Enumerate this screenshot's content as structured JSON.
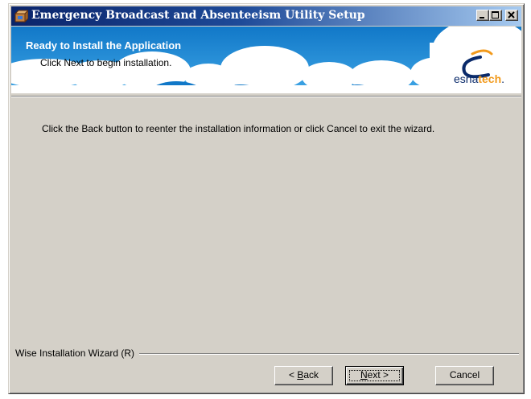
{
  "window": {
    "title": "Emergency Broadcast and Absenteeism Utility Setup",
    "icon": "setup-box-icon",
    "controls": [
      "minimize-icon",
      "maximize-icon",
      "close-icon"
    ]
  },
  "banner": {
    "title": "Ready to Install the Application",
    "subtitle": "Click Next to begin installation.",
    "logo": {
      "prefix": "esna",
      "accent": "tech",
      "suffix": "."
    }
  },
  "body": {
    "text": "Click the Back button to reenter the installation information or click Cancel to exit the wizard."
  },
  "footer": {
    "label": "Wise Installation Wizard (R)"
  },
  "buttons": {
    "back": {
      "prefix": "< ",
      "mnemonic": "B",
      "rest": "ack"
    },
    "next": {
      "mnemonic": "N",
      "rest": "ext >"
    },
    "cancel": "Cancel"
  },
  "colors": {
    "titlebar_start": "#0a246a",
    "banner_sky": "#1f8fd6",
    "logo_accent": "#f29a1c",
    "dialog_face": "#d4d0c8"
  }
}
